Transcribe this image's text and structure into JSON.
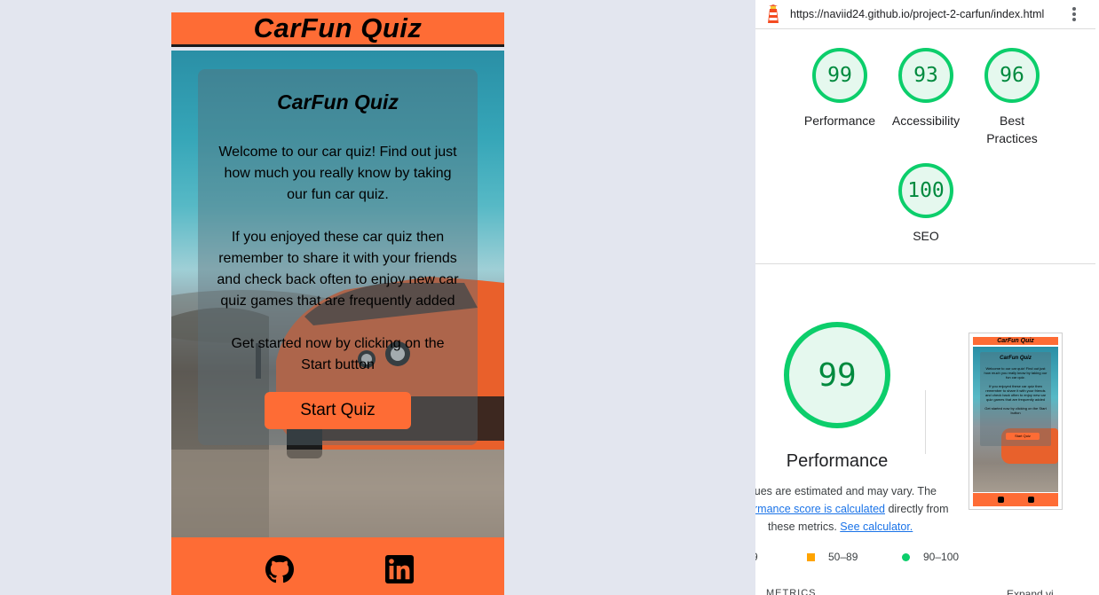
{
  "site": {
    "header_title": "CarFun Quiz",
    "card": {
      "title": "CarFun Quiz",
      "para1": "Welcome to our car quiz! Find out just how much you really know by taking our fun car quiz.",
      "para2": "If you enjoyed these car quiz then remember to share it with your friends and check back often to enjoy new car quiz games that are frequently added",
      "para3": "Get started now by clicking on the Start button",
      "start_button": "Start Quiz"
    },
    "footer_icons": [
      "github-icon",
      "linkedin-icon"
    ],
    "colors": {
      "brand_orange": "#fe6c35"
    }
  },
  "lighthouse": {
    "url": "https://naviid24.github.io/project-2-carfun/index.html",
    "scores": [
      {
        "label": "Performance",
        "value": "99"
      },
      {
        "label": "Accessibility",
        "value": "93"
      },
      {
        "label": "Best Practices",
        "value": "96"
      },
      {
        "label": "SEO",
        "value": "100"
      }
    ],
    "detail": {
      "score": "99",
      "label": "Performance",
      "note_line1": "lues are estimated and may vary. The",
      "note_link1": "rmance score is calculated",
      "note_line2_rest": " directly from",
      "note_line3": "these metrics. ",
      "note_link2": "See calculator.",
      "thumb": {
        "title": "CarFun Quiz",
        "lines": [
          "Welcome to our car quiz! Find out just how much you really know by taking our fun car quiz.",
          "If you enjoyed these car quiz then remember to share it with your friends and check back often to enjoy new car quiz games that are frequently added",
          "Get started now by clicking on the Start button"
        ],
        "button": "Start Quiz"
      }
    },
    "legend": [
      {
        "label": "9",
        "color": "#ff4e42"
      },
      {
        "label": "50–89",
        "color": "#ffa400"
      },
      {
        "label": "90–100",
        "color": "#0cce6b"
      }
    ],
    "metrics_cut": "METRICS",
    "expand_cut": "Expand vi",
    "colors": {
      "pass_green": "#0cce6b",
      "pass_text": "#008a3e",
      "pass_bg": "#e5f8ee"
    }
  }
}
